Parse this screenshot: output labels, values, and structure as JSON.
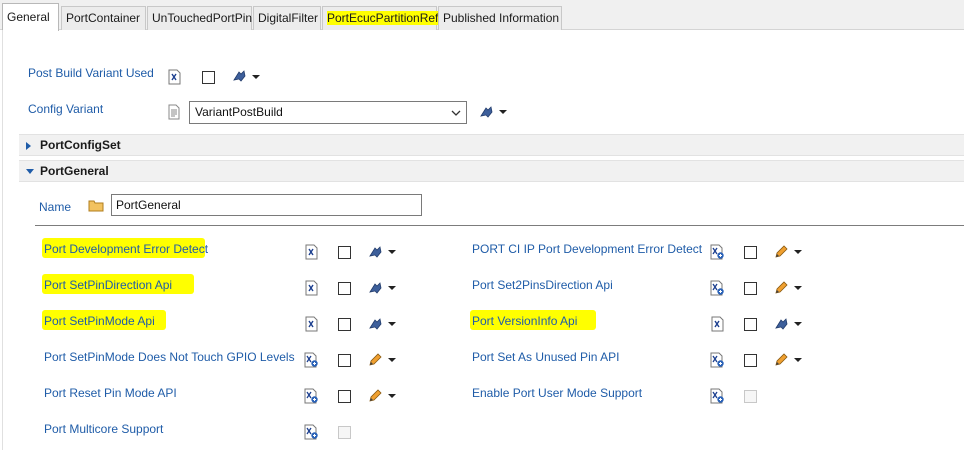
{
  "tabs": [
    {
      "label": "General",
      "active": true,
      "highlight": false
    },
    {
      "label": "PortContainer",
      "active": false,
      "highlight": false
    },
    {
      "label": "UnTouchedPortPin",
      "active": false,
      "highlight": false
    },
    {
      "label": "DigitalFilter",
      "active": false,
      "highlight": false
    },
    {
      "label": "PortEcucPartitionRef",
      "active": false,
      "highlight": true
    },
    {
      "label": "Published Information",
      "active": false,
      "highlight": false
    }
  ],
  "top": {
    "post_build_variant_label": "Post Build Variant Used",
    "config_variant_label": "Config Variant",
    "config_variant_value": "VariantPostBuild"
  },
  "sections": {
    "port_config_set": "PortConfigSet",
    "port_general": "PortGeneral"
  },
  "general": {
    "name_label": "Name",
    "name_value": "PortGeneral"
  },
  "left_params": [
    {
      "label": "Port Development Error Detect",
      "highlight": true,
      "icon": "xdm-icon",
      "edit": "link",
      "checked": false
    },
    {
      "label": "Port SetPinDirection Api",
      "highlight": true,
      "icon": "xdm-icon",
      "edit": "link",
      "checked": false
    },
    {
      "label": "Port SetPinMode Api",
      "highlight": true,
      "icon": "xdm-icon",
      "edit": "link",
      "checked": false
    },
    {
      "label": "Port SetPinMode Does Not Touch GPIO Levels",
      "highlight": false,
      "icon": "xdm-calc-icon",
      "edit": "pencil",
      "checked": false
    },
    {
      "label": "Port Reset Pin Mode API",
      "highlight": false,
      "icon": "xdm-calc-icon",
      "edit": "pencil",
      "checked": false
    },
    {
      "label": "Port Multicore Support",
      "highlight": false,
      "icon": "xdm-calc-icon",
      "edit": "none",
      "checked": false
    }
  ],
  "right_params": [
    {
      "label": "PORT CI IP Port Development Error Detect",
      "highlight": false,
      "icon": "xdm-calc-icon",
      "edit": "pencil",
      "checked": false
    },
    {
      "label": "Port Set2PinsDirection Api",
      "highlight": false,
      "icon": "xdm-calc-icon",
      "edit": "pencil",
      "checked": false
    },
    {
      "label": "Port VersionInfo Api",
      "highlight": true,
      "icon": "xdm-icon",
      "edit": "link",
      "checked": false
    },
    {
      "label": "Port Set As Unused Pin API",
      "highlight": false,
      "icon": "xdm-calc-icon",
      "edit": "pencil",
      "checked": false
    },
    {
      "label": "Enable Port User Mode Support",
      "highlight": false,
      "icon": "xdm-calc-icon",
      "edit": "none",
      "checked": false
    }
  ],
  "colors": {
    "highlight": "#ffff00",
    "label_blue": "#1f5ca8"
  }
}
